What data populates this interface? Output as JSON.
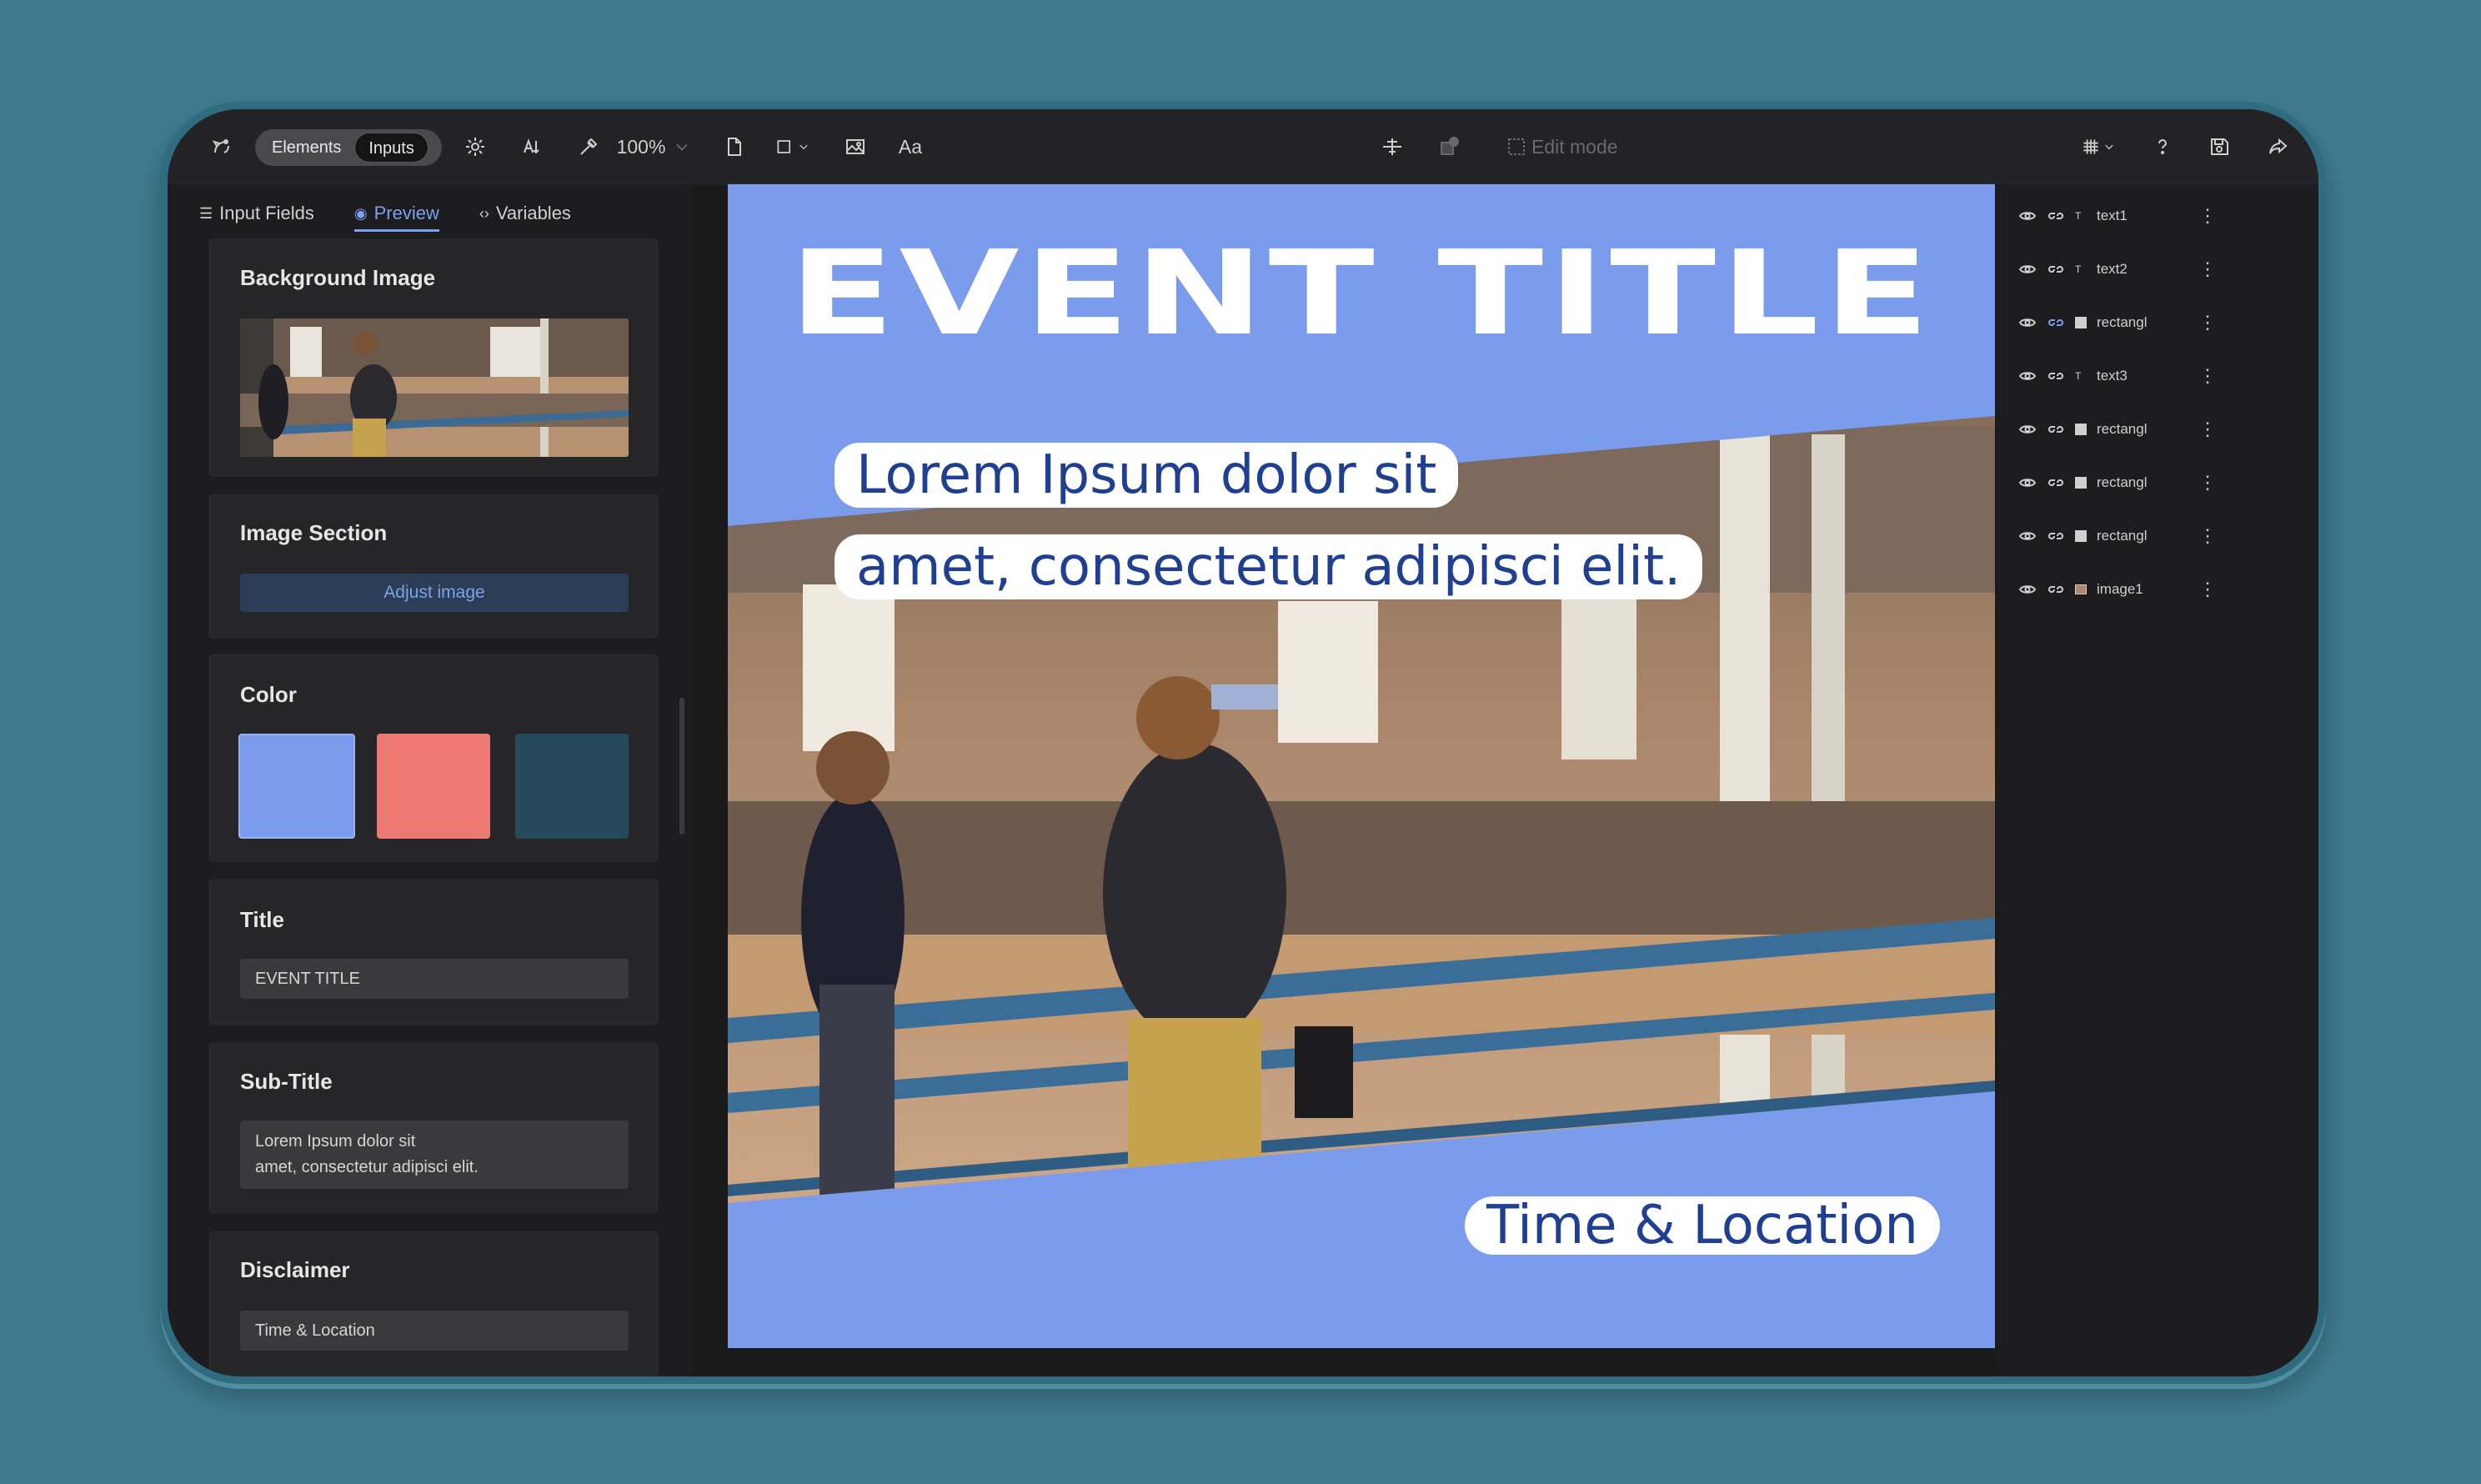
{
  "toolbar": {
    "seg_elements": "Elements",
    "seg_inputs": "Inputs",
    "zoom": "100%",
    "text_tool": "Aa",
    "edit_mode": "Edit mode"
  },
  "left_panel": {
    "tabs": [
      {
        "label": "Input Fields"
      },
      {
        "label": "Preview"
      },
      {
        "label": "Variables"
      }
    ],
    "background_image": {
      "heading": "Background Image"
    },
    "image_section": {
      "heading": "Image Section",
      "button": "Adjust image"
    },
    "color": {
      "heading": "Color",
      "swatches": [
        "#7b9bec",
        "#ec7a72",
        "#254a5c"
      ]
    },
    "title": {
      "heading": "Title",
      "value": "EVENT TITLE"
    },
    "subtitle": {
      "heading": "Sub-Title",
      "value": "Lorem Ipsum dolor sit\namet, consectetur adipisci elit."
    },
    "disclaimer": {
      "heading": "Disclaimer",
      "value": "Time & Location"
    }
  },
  "poster": {
    "title": "EVENT TITLE",
    "subtitle_line1": "Lorem Ipsum dolor sit",
    "subtitle_line2": "amet, consectetur adipisci elit.",
    "disclaimer": "Time & Location",
    "background": "#7b9bec",
    "text_color": "#1f3f93"
  },
  "layers": [
    {
      "label": "text1",
      "type": "text"
    },
    {
      "label": "text2",
      "type": "text"
    },
    {
      "label": "rectangl",
      "type": "rect"
    },
    {
      "label": "text3",
      "type": "text"
    },
    {
      "label": "rectangl",
      "type": "rect"
    },
    {
      "label": "rectangl",
      "type": "rect"
    },
    {
      "label": "rectangl",
      "type": "rect"
    },
    {
      "label": "image1",
      "type": "image"
    }
  ]
}
